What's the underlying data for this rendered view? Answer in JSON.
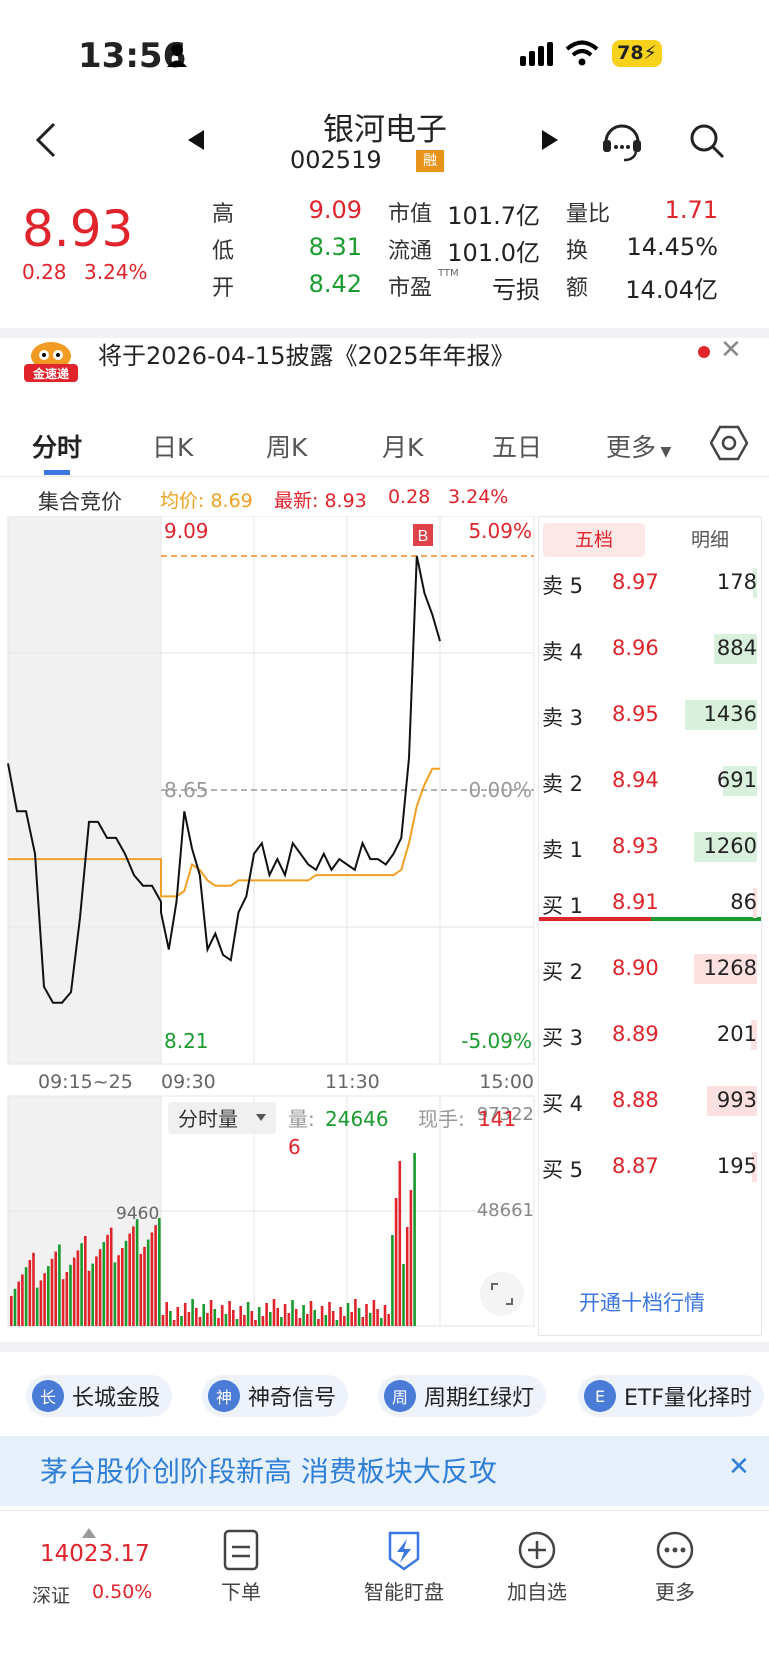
{
  "status": {
    "time": "13:56",
    "battery": "78"
  },
  "nav": {
    "title": "银河电子",
    "code": "002519",
    "tag": "融"
  },
  "quote": {
    "price": "8.93",
    "change": "0.28",
    "change_pct": "3.24%",
    "stats": [
      {
        "label": "高",
        "value": "9.09",
        "color": "#e0242b"
      },
      {
        "label": "低",
        "value": "8.31",
        "color": "#1a9b2e"
      },
      {
        "label": "开",
        "value": "8.42",
        "color": "#1a9b2e"
      },
      {
        "label": "市值",
        "value": "101.7亿",
        "color": "#222"
      },
      {
        "label": "流通",
        "value": "101.0亿",
        "color": "#222"
      },
      {
        "label": "市盈",
        "sup": "TTM",
        "value": "亏损",
        "color": "#222"
      },
      {
        "label": "量比",
        "value": "1.71",
        "color": "#e0242b"
      },
      {
        "label": "换",
        "value": "14.45%",
        "color": "#222"
      },
      {
        "label": "额",
        "value": "14.04亿",
        "color": "#222"
      }
    ]
  },
  "notice": {
    "logo": "金速递",
    "text": "将于2026-04-15披露《2025年年报》"
  },
  "tabs": [
    "分时",
    "日K",
    "周K",
    "月K",
    "五日",
    "更多"
  ],
  "chart_header": {
    "auction": "集合竞价",
    "avg": "均价: 8.69",
    "latest": "最新: 8.93",
    "chg": "0.28",
    "pct": "3.24%"
  },
  "chart_labels": {
    "top_price": "9.09",
    "top_pct": "5.09%",
    "mid_price": "8.65",
    "mid_pct": "0.00%",
    "bot_price": "8.21",
    "bot_pct": "-5.09%",
    "t1": "09:15~25",
    "t2": "09:30",
    "t3": "11:30",
    "t4": "15:00",
    "b_marker": "B"
  },
  "volume": {
    "selector": "分时量",
    "vol_label": "量:",
    "vol_value": "24646",
    "hand_label": "现手:",
    "hand_value": "141",
    "hand_extra": "6",
    "max": "97322",
    "mid": "48661",
    "auction_peak": "9460"
  },
  "chart_data": {
    "type": "line",
    "series": [
      {
        "name": "price",
        "values": [
          8.7,
          8.61,
          8.61,
          8.53,
          8.28,
          8.25,
          8.25,
          8.27,
          8.41,
          8.59,
          8.59,
          8.56,
          8.56,
          8.53,
          8.49,
          8.47,
          8.47,
          8.44,
          8.42,
          8.35,
          8.44,
          8.61,
          8.54,
          8.49,
          8.35,
          8.38,
          8.34,
          8.33,
          8.42,
          8.45,
          8.53,
          8.55,
          8.49,
          8.52,
          8.49,
          8.55,
          8.53,
          8.51,
          8.5,
          8.53,
          8.5,
          8.52,
          8.51,
          8.5,
          8.55,
          8.52,
          8.52,
          8.51,
          8.53,
          8.56,
          8.71,
          9.09,
          9.02,
          8.98,
          8.93
        ]
      },
      {
        "name": "avg",
        "values": [
          8.52,
          8.52,
          8.52,
          8.52,
          8.52,
          8.52,
          8.52,
          8.52,
          8.52,
          8.52,
          8.52,
          8.52,
          8.52,
          8.52,
          8.52,
          8.52,
          8.52,
          8.52,
          8.45,
          8.45,
          8.45,
          8.46,
          8.51,
          8.5,
          8.48,
          8.47,
          8.47,
          8.47,
          8.48,
          8.48,
          8.48,
          8.48,
          8.48,
          8.48,
          8.48,
          8.48,
          8.48,
          8.48,
          8.49,
          8.49,
          8.49,
          8.49,
          8.49,
          8.49,
          8.49,
          8.49,
          8.49,
          8.49,
          8.49,
          8.5,
          8.55,
          8.62,
          8.66,
          8.69,
          8.69
        ]
      }
    ],
    "ylim": [
      8.21,
      9.09
    ]
  },
  "orderbook": {
    "tabs": [
      "五档",
      "明细"
    ],
    "asks": [
      {
        "label": "卖 5",
        "price": "8.97",
        "vol": "178",
        "bar": 0.05
      },
      {
        "label": "卖 4",
        "price": "8.96",
        "vol": "884",
        "bar": 0.6
      },
      {
        "label": "卖 3",
        "price": "8.95",
        "vol": "1436",
        "bar": 1.0
      },
      {
        "label": "卖 2",
        "price": "8.94",
        "vol": "691",
        "bar": 0.47
      },
      {
        "label": "卖 1",
        "price": "8.93",
        "vol": "1260",
        "bar": 0.88
      }
    ],
    "bids": [
      {
        "label": "买 1",
        "price": "8.91",
        "vol": "86",
        "bar": 0.05
      },
      {
        "label": "买 2",
        "price": "8.90",
        "vol": "1268",
        "bar": 0.88
      },
      {
        "label": "买 3",
        "price": "8.89",
        "vol": "201",
        "bar": 0.08
      },
      {
        "label": "买 4",
        "price": "8.88",
        "vol": "993",
        "bar": 0.7
      },
      {
        "label": "买 5",
        "price": "8.87",
        "vol": "195",
        "bar": 0.07
      }
    ],
    "more": "开通十档行情"
  },
  "pills": [
    {
      "icon": "长",
      "label": "长城金股"
    },
    {
      "icon": "神",
      "label": "神奇信号"
    },
    {
      "icon": "周",
      "label": "周期红绿灯"
    },
    {
      "icon": "E",
      "label": "ETF量化择时"
    }
  ],
  "banner": "茅台股价创阶段新高 消费板块大反攻",
  "bottom": {
    "index_value": "14023.17",
    "index_name": "深证",
    "index_pct": "0.50%",
    "tabs": [
      "下单",
      "智能盯盘",
      "加自选",
      "更多"
    ]
  }
}
